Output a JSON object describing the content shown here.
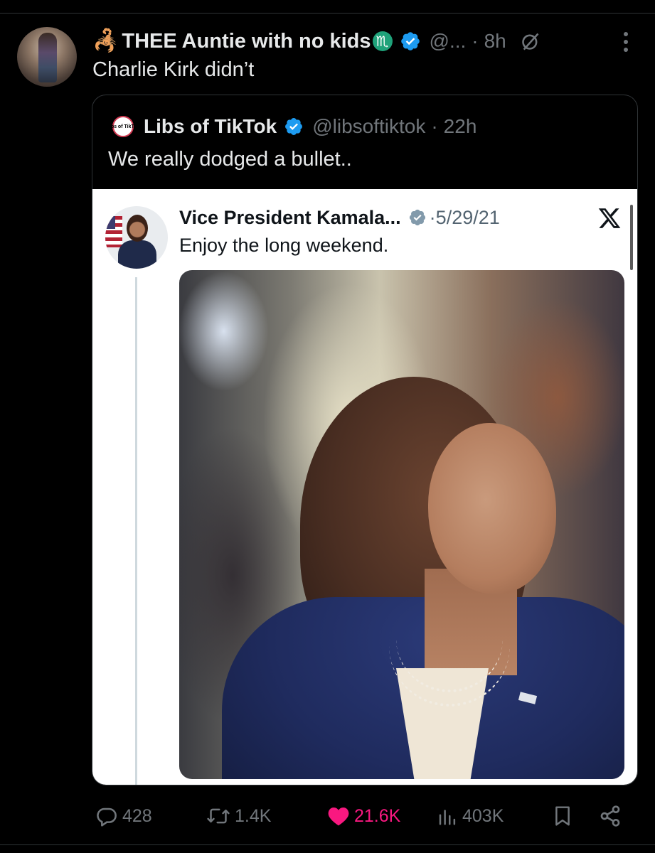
{
  "tweet": {
    "display_name": "THEE Auntie with no kids",
    "handle": "@...",
    "separator": "·",
    "time": "8h",
    "text": "Charlie Kirk didn’t",
    "zodiac_glyph": "♏",
    "emoji_icon": "scorpion-icon"
  },
  "quote": {
    "display_name": "Libs of TikTok",
    "handle": "@libsoftiktok",
    "separator": "·",
    "time": "22h",
    "text": "We really dodged a bullet..",
    "avatar_text": "Libs of TikTok"
  },
  "embedded": {
    "display_name": "Vice President Kamala...",
    "separator": "·",
    "date": "5/29/21",
    "text": "Enjoy the long weekend."
  },
  "actions": {
    "replies": "428",
    "reposts": "1.4K",
    "likes": "21.6K",
    "views": "403K"
  },
  "colors": {
    "background": "#000000",
    "text": "#e7e9ea",
    "muted": "#71767b",
    "verified": "#1d9bf0",
    "like": "#f91880",
    "border": "#2f3336"
  }
}
